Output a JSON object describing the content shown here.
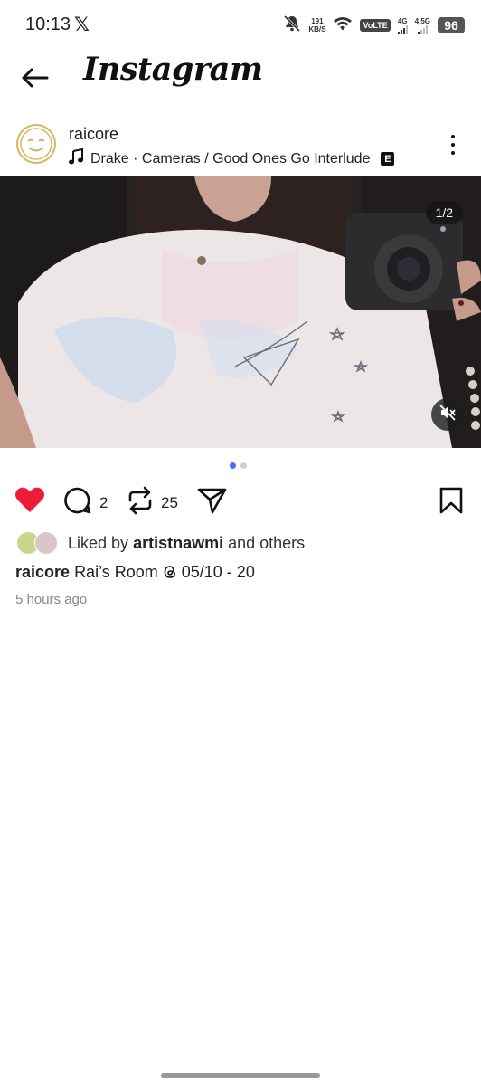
{
  "status_bar": {
    "time": "10:13",
    "app_notification": "𝕏",
    "net_speed_value": "191",
    "net_speed_unit": "KB/S",
    "volte": "VoLTE",
    "sim1_type": "4G",
    "sim2_type": "4.5G",
    "battery": "96"
  },
  "header": {
    "brand": "Instagram"
  },
  "post": {
    "username": "raicore",
    "music": "Drake · Cameras / Good Ones Go Interlude",
    "explicit": "E",
    "counter": "1/2",
    "carousel_page": 1,
    "carousel_total": 2,
    "comments": "2",
    "reposts": "25",
    "liked_by_prefix": "Liked by",
    "liked_by_user": "artistnawmi",
    "liked_by_suffix": "and others",
    "caption_user": "raicore",
    "caption_text": "Rai’s Room ",
    "caption_date": " 05/10 - 20",
    "timestamp": "5 hours ago"
  },
  "colors": {
    "like_red": "#ed1d3a",
    "dot_active": "#4a6cf7",
    "dot_inactive": "#d0d0d0",
    "avatar_ring": "#d6b75d"
  },
  "icons": {
    "back": "arrow-left-icon",
    "more": "three-dots-vertical-icon",
    "music": "music-note-icon",
    "mute": "speaker-muted-icon",
    "like": "heart-filled-icon",
    "comment": "speech-bubble-icon",
    "repost": "repost-arrows-icon",
    "share": "paper-plane-icon",
    "save": "bookmark-icon",
    "threads": "threads-icon"
  }
}
